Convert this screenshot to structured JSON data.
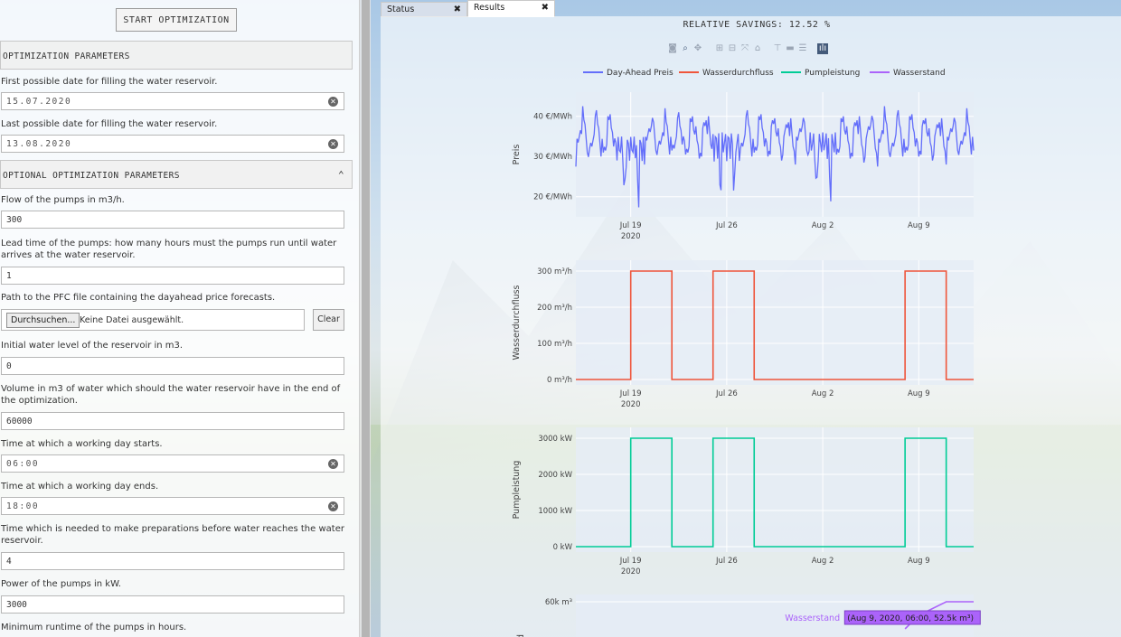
{
  "left": {
    "start_button": "START OPTIMIZATION",
    "section1": "OPTIMIZATION PARAMETERS",
    "first_date_label": "First possible date for filling the water reservoir.",
    "first_date_value": "15.07.2020",
    "last_date_label": "Last possible date for filling the water reservoir.",
    "last_date_value": "13.08.2020",
    "section2": "OPTIONAL OPTIMIZATION PARAMETERS",
    "flow_label": "Flow of the pumps in m3/h.",
    "flow_value": "300",
    "lead_label": "Lead time of the pumps: how many hours must the pumps run until water arrives at the water reservoir.",
    "lead_value": "1",
    "pfc_label": "Path to the PFC file containing the dayahead price forecasts.",
    "browse_button": "Durchsuchen...",
    "no_file": "Keine Datei ausgewählt.",
    "clear_button": "Clear",
    "initial_label": "Initial water level of the reservoir in m3.",
    "initial_value": "0",
    "volume_label": "Volume in m3 of water which should the water reservoir have in the end of the optimization.",
    "volume_value": "60000",
    "start_label": "Time at which a working day starts.",
    "start_value": "06:00",
    "end_label": "Time at which a working day ends.",
    "end_value": "18:00",
    "prep_label": "Time which is needed to make preparations before water reaches the water reservoir.",
    "prep_value": "4",
    "power_label": "Power of the pumps in kW.",
    "power_value": "3000",
    "minrun_label": "Minimum runtime of the pumps in hours."
  },
  "tabs": [
    {
      "label": "Status",
      "close": "✖"
    },
    {
      "label": "Results",
      "close": "✖"
    }
  ],
  "results": {
    "savings": "RELATIVE SAVINGS: 12.52 %",
    "legend": [
      "Day-Ahead Preis",
      "Wasserdurchfluss",
      "Pumpleistung",
      "Wasserstand"
    ],
    "tooltip_series": "Wasserstand",
    "tooltip_value": "(Aug 9, 2020, 06:00, 52.5k m³)"
  },
  "colors": {
    "price": "#636efa",
    "flow": "#ef553b",
    "power": "#00cc96",
    "level": "#ab63fa",
    "plot_bg": "#e5ecf6"
  },
  "chart_data": [
    {
      "type": "line",
      "series": [
        {
          "name": "Day-Ahead Preis"
        }
      ],
      "ylabel": "Preis",
      "yticks": [
        "20 €/MWh",
        "30 €/MWh",
        "40 €/MWh"
      ],
      "ylim": [
        15,
        46
      ],
      "xticks": [
        "Jul 19\n2020",
        "Jul 26",
        "Aug 2",
        "Aug 9"
      ],
      "x_range": [
        "2020-07-15",
        "2020-08-13"
      ],
      "daily_profile": {
        "day_low": 30,
        "day_high": 40,
        "weekend_dips": [
          [
            18,
            19,
            17
          ],
          [
            25,
            26,
            18
          ],
          [
            32,
            33,
            18
          ]
        ]
      }
    },
    {
      "type": "line",
      "series": [
        {
          "name": "Wasserdurchfluss"
        }
      ],
      "ylabel": "Wasserdurchfluss",
      "yticks": [
        "0 m³/h",
        "100 m³/h",
        "200 m³/h",
        "300 m³/h"
      ],
      "ylim": [
        -15,
        330
      ],
      "xticks": [
        "Jul 19\n2020",
        "Jul 26",
        "Aug 2",
        "Aug 9"
      ],
      "steps": [
        {
          "x": "2020-07-15",
          "y": 0
        },
        {
          "x": "2020-07-19",
          "y": 300
        },
        {
          "x": "2020-07-22",
          "y": 0
        },
        {
          "x": "2020-07-25",
          "y": 300
        },
        {
          "x": "2020-07-28",
          "y": 0
        },
        {
          "x": "2020-08-08",
          "y": 300
        },
        {
          "x": "2020-08-11",
          "y": 0
        },
        {
          "x": "2020-08-13",
          "y": 0
        }
      ]
    },
    {
      "type": "line",
      "series": [
        {
          "name": "Pumpleistung"
        }
      ],
      "ylabel": "Pumpleistung",
      "yticks": [
        "0 kW",
        "1000 kW",
        "2000 kW",
        "3000 kW"
      ],
      "ylim": [
        -150,
        3300
      ],
      "xticks": [
        "Jul 19\n2020",
        "Jul 26",
        "Aug 2",
        "Aug 9"
      ],
      "steps": [
        {
          "x": "2020-07-15",
          "y": 0
        },
        {
          "x": "2020-07-19",
          "y": 3000
        },
        {
          "x": "2020-07-22",
          "y": 0
        },
        {
          "x": "2020-07-25",
          "y": 3000
        },
        {
          "x": "2020-07-28",
          "y": 0
        },
        {
          "x": "2020-08-08",
          "y": 3000
        },
        {
          "x": "2020-08-11",
          "y": 0
        },
        {
          "x": "2020-08-13",
          "y": 0
        }
      ]
    },
    {
      "type": "line",
      "series": [
        {
          "name": "Wasserstand"
        }
      ],
      "yticks": [
        "60k m³"
      ],
      "points": [
        {
          "x": "2020-08-09",
          "y": 52500
        },
        {
          "x": "2020-08-11",
          "y": 60000
        },
        {
          "x": "2020-08-13",
          "y": 60000
        }
      ]
    }
  ]
}
